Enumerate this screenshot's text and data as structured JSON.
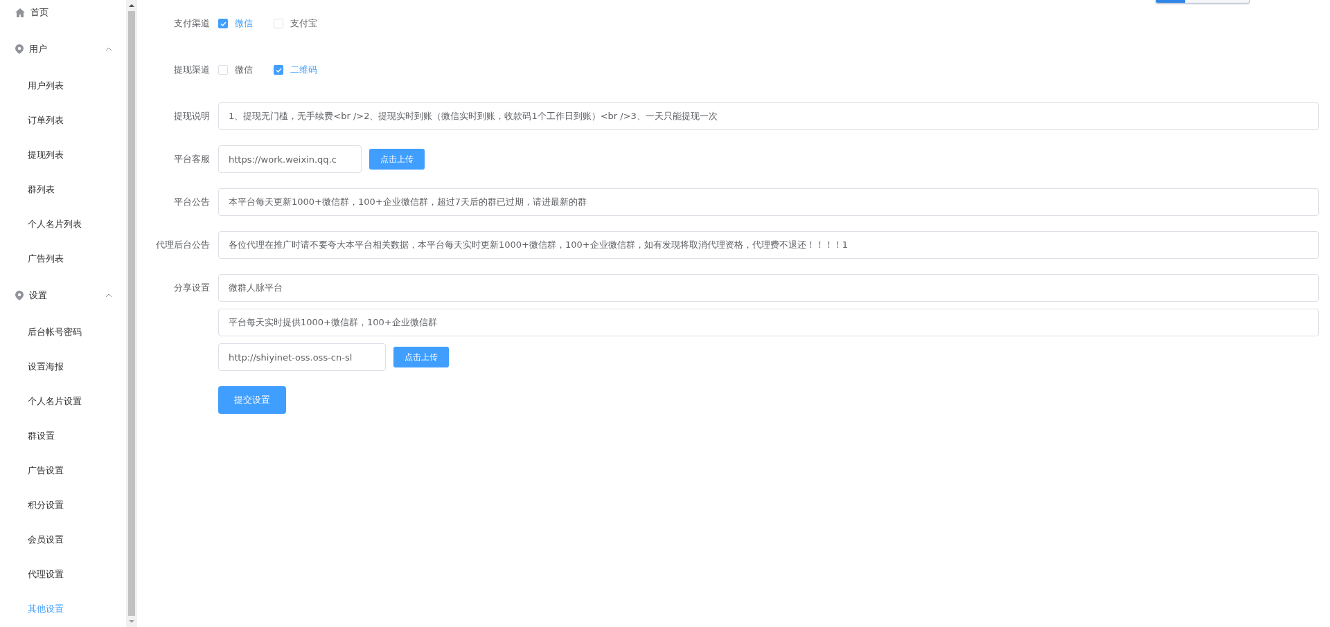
{
  "sidebar": {
    "items": [
      {
        "kind": "link",
        "label": "首页",
        "selected": false
      },
      {
        "kind": "group",
        "label": "用户",
        "expanded": true,
        "children": [
          {
            "label": "用户列表",
            "selected": false
          },
          {
            "label": "订单列表",
            "selected": false
          },
          {
            "label": "提现列表",
            "selected": false
          },
          {
            "label": "群列表",
            "selected": false
          },
          {
            "label": "个人名片列表",
            "selected": false
          },
          {
            "label": "广告列表",
            "selected": false
          }
        ]
      },
      {
        "kind": "group",
        "label": "设置",
        "expanded": true,
        "children": [
          {
            "label": "后台帐号密码",
            "selected": false
          },
          {
            "label": "设置海报",
            "selected": false
          },
          {
            "label": "个人名片设置",
            "selected": false
          },
          {
            "label": "群设置",
            "selected": false
          },
          {
            "label": "广告设置",
            "selected": false
          },
          {
            "label": "积分设置",
            "selected": false
          },
          {
            "label": "会员设置",
            "selected": false
          },
          {
            "label": "代理设置",
            "selected": false
          },
          {
            "label": "其他设置",
            "selected": true
          }
        ]
      }
    ]
  },
  "form": {
    "rows": [
      {
        "kind": "checkboxes",
        "label": "支付渠道",
        "options": [
          {
            "label": "微信",
            "checked": true
          },
          {
            "label": "支付宝",
            "checked": false
          }
        ]
      },
      {
        "kind": "checkboxes",
        "label": "提现渠道",
        "options": [
          {
            "label": "微信",
            "checked": false
          },
          {
            "label": "二维码",
            "checked": true
          }
        ]
      },
      {
        "kind": "fields",
        "label": "提现说明",
        "fields": [
          {
            "kind": "text",
            "value": "1、提现无门槛，无手续费<br />2、提现实时到账（微信实时到账，收款码1个工作日到账）<br />3、一天只能提现一次"
          }
        ]
      },
      {
        "kind": "fields",
        "label": "平台客服",
        "fields": [
          {
            "kind": "upload",
            "value": "https://work.weixin.qq.c",
            "button": "点击上传"
          }
        ]
      },
      {
        "kind": "fields",
        "label": "平台公告",
        "fields": [
          {
            "kind": "text",
            "value": "本平台每天更新1000+微信群，100+企业微信群，超过7天后的群已过期，请进最新的群"
          }
        ]
      },
      {
        "kind": "fields",
        "label": "代理后台公告",
        "fields": [
          {
            "kind": "text",
            "value": "各位代理在推广时请不要夸大本平台相关数据，本平台每天实时更新1000+微信群，100+企业微信群，如有发现将取消代理资格，代理费不退还！！！！1"
          }
        ]
      },
      {
        "kind": "fields",
        "label": "分享设置",
        "fields": [
          {
            "kind": "text",
            "value": "微群人脉平台"
          },
          {
            "kind": "text",
            "value": "平台每天实时提供1000+微信群，100+企业微信群"
          },
          {
            "kind": "upload",
            "value": "http://shiyinet-oss.oss-cn-sl",
            "button": "点击上传"
          }
        ]
      }
    ],
    "submit": "提交设置"
  }
}
